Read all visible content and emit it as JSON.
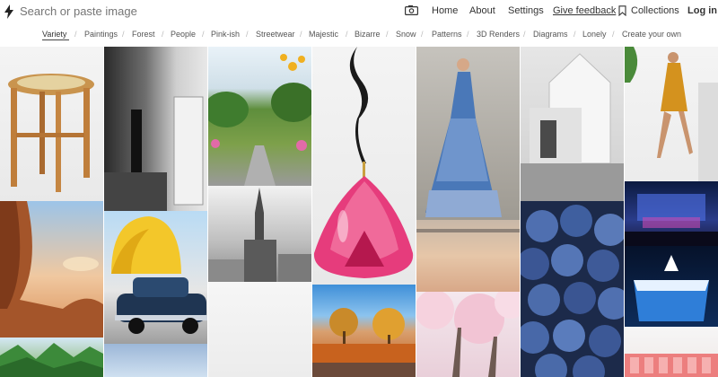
{
  "header": {
    "search_placeholder": "Search or paste image",
    "nav": {
      "home": "Home",
      "about": "About",
      "settings": "Settings",
      "feedback": "Give feedback",
      "collections": "Collections",
      "login": "Log in"
    }
  },
  "categories": [
    "Variety",
    "Paintings",
    "Forest",
    "People",
    "Pink-ish",
    "Streetwear",
    "Majestic",
    "Bizarre",
    "Snow",
    "Patterns",
    "3D Renders",
    "Diagrams",
    "Lonely",
    "Create your own"
  ],
  "active_category": "Variety",
  "colors": {
    "text_dark": "#222222",
    "placeholder": "#9a9a9a",
    "separator": "#bbbbbb"
  }
}
